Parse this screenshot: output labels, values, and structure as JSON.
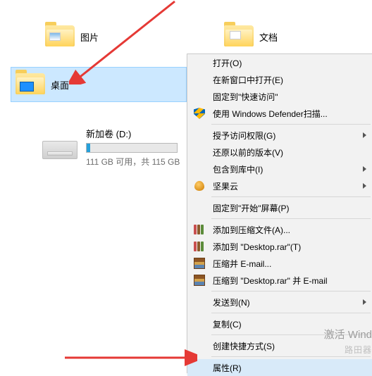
{
  "folders": {
    "pictures": "图片",
    "documents": "文档",
    "desktop": "桌面"
  },
  "drive": {
    "name": "新加卷 (D:)",
    "stats": "111 GB 可用，共 115 GB"
  },
  "menu": {
    "open": "打开(O)",
    "open_new_window": "在新窗口中打开(E)",
    "pin_quick": "固定到\"快速访问\"",
    "defender": "使用 Windows Defender扫描...",
    "grant_access": "授予访问权限(G)",
    "restore_prev": "还原以前的版本(V)",
    "include_lib": "包含到库中(I)",
    "jianguoyun": "坚果云",
    "pin_start": "固定到\"开始\"屏幕(P)",
    "archive_add": "添加到压缩文件(A)...",
    "archive_desktop": "添加到 \"Desktop.rar\"(T)",
    "archive_email": "压缩并 E-mail...",
    "archive_desktop_email": "压缩到 \"Desktop.rar\" 并 E-mail",
    "send_to": "发送到(N)",
    "copy": "复制(C)",
    "create_shortcut": "创建快捷方式(S)",
    "properties": "属性(R)"
  },
  "misc": {
    "activate": "激活 Wind",
    "watermark": "路田器"
  }
}
